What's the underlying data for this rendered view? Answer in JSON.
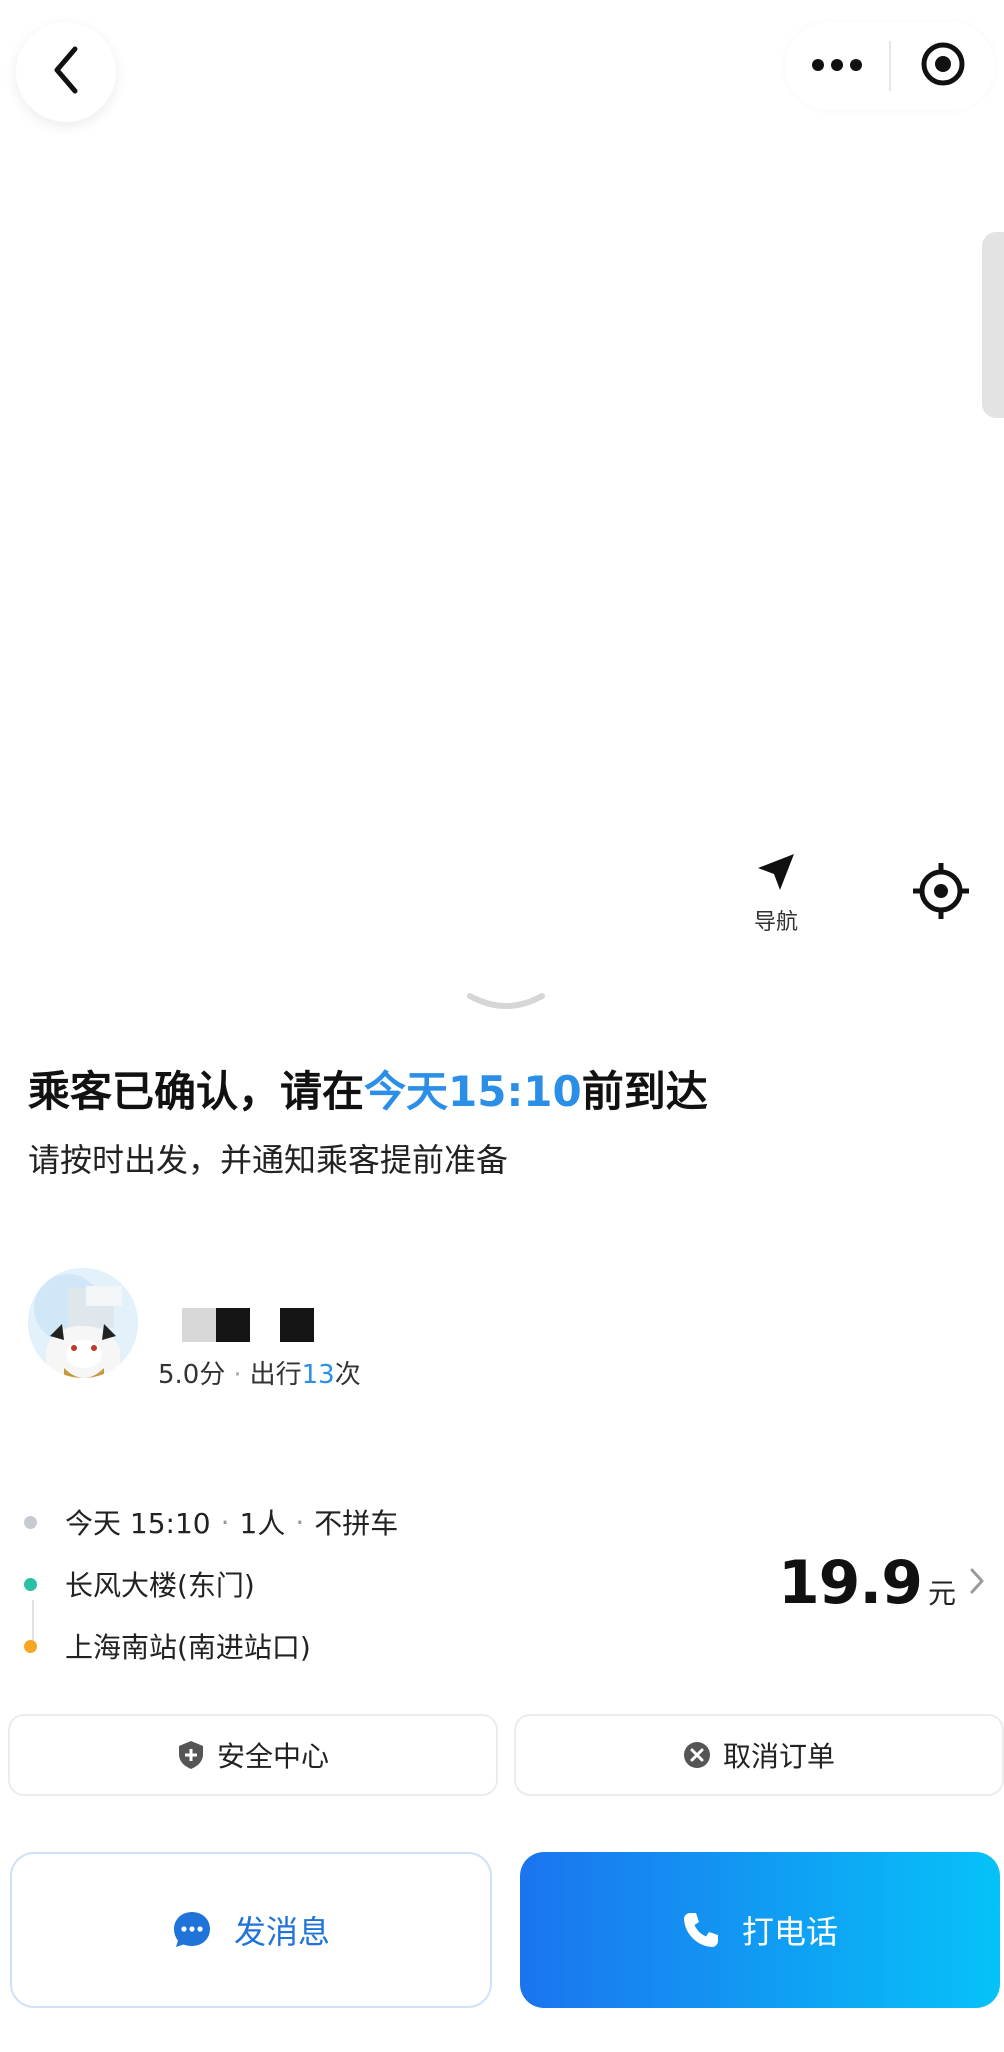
{
  "map": {
    "nav_label": "导航"
  },
  "status": {
    "title_prefix": "乘客已确认，请在",
    "title_highlight": "今天15:10",
    "title_suffix": "前到达",
    "subtitle": "请按时出发，并通知乘客提前准备"
  },
  "passenger": {
    "rating": "5.0分",
    "trips_prefix": "出行",
    "trips_count": "13",
    "trips_suffix": "次"
  },
  "trip": {
    "time": "今天 15:10",
    "seats": "1人",
    "share": "不拼车",
    "pickup": "长风大楼(东门)",
    "dropoff": "上海南站(南进站口)",
    "price": "19.9",
    "price_unit": "元"
  },
  "actions": {
    "safety": "安全中心",
    "cancel": "取消订单",
    "message": "发消息",
    "call": "打电话"
  },
  "colors": {
    "accent": "#2b8fe8",
    "pickup_dot": "#2bbfa4",
    "dropoff_dot": "#f5a623",
    "time_dot": "#c7cbd1"
  }
}
